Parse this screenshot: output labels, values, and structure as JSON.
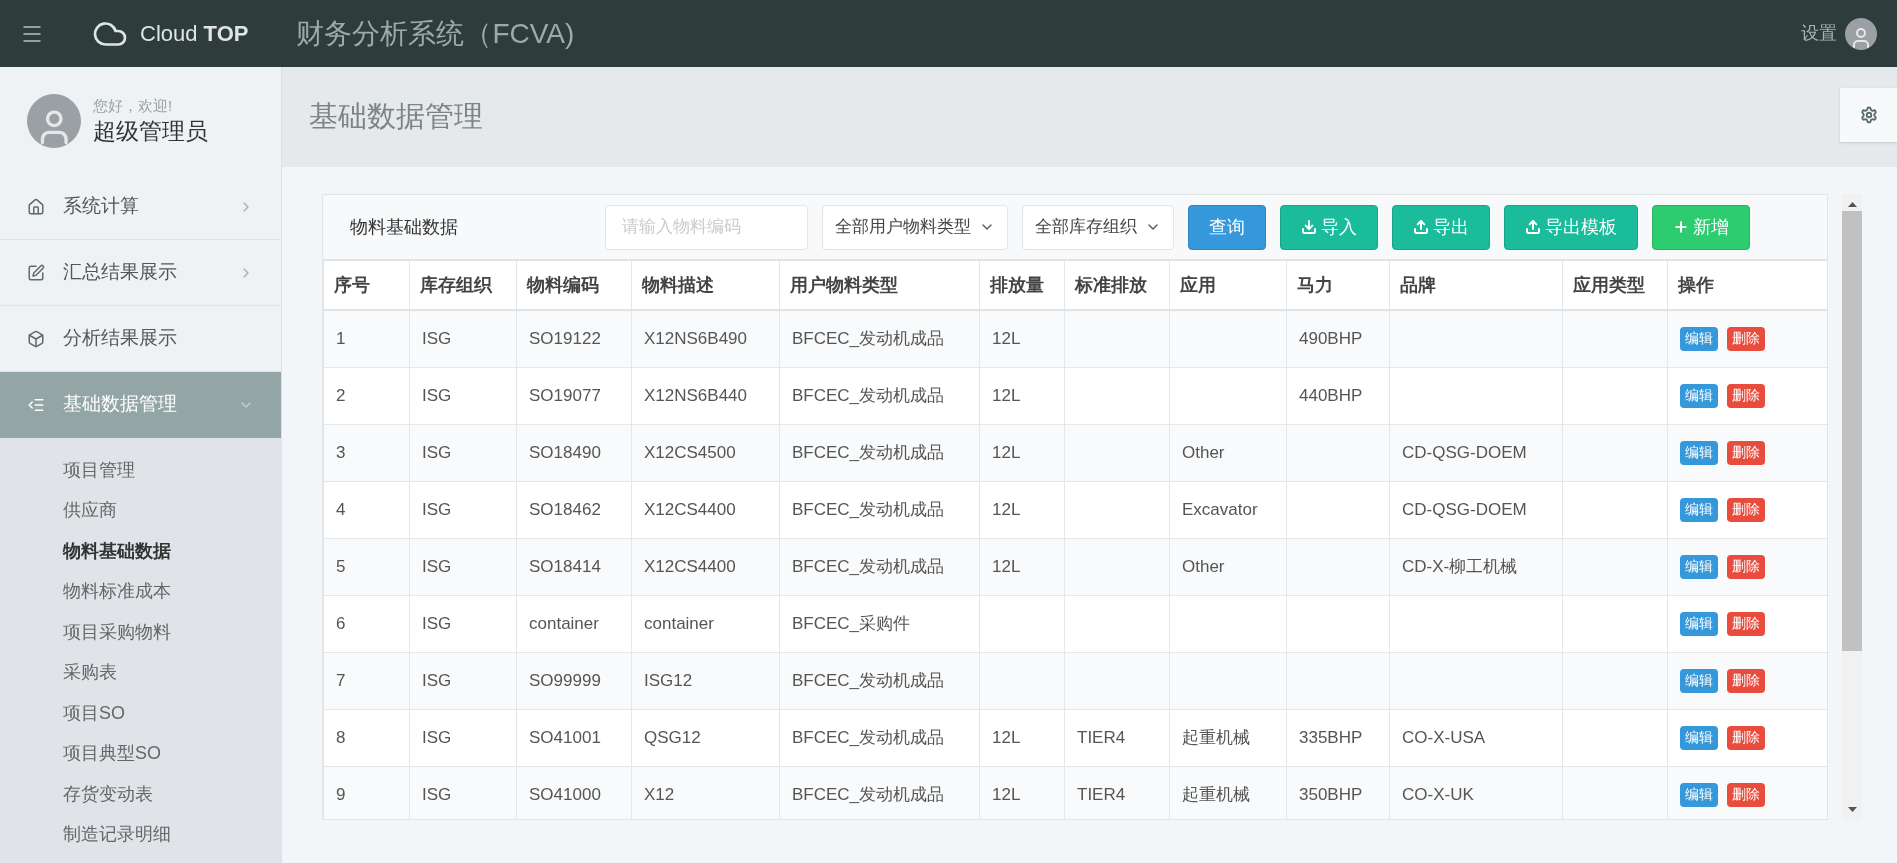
{
  "header": {
    "brand": "Cloud **TOP**",
    "title": "财务分析系统（FCVA)",
    "settings_label": "设置"
  },
  "user": {
    "greeting": "您好，欢迎!",
    "name": "超级管理员"
  },
  "sidebar": {
    "items": [
      {
        "label": "系统计算",
        "kind": "group",
        "selected": false,
        "expanded": false
      },
      {
        "label": "汇总结果展示",
        "kind": "group",
        "selected": false,
        "expanded": false
      },
      {
        "label": "分析结果展示",
        "kind": "link",
        "selected": false
      },
      {
        "label": "基础数据管理",
        "kind": "group",
        "selected": true,
        "expanded": true,
        "children": [
          {
            "label": "项目管理",
            "selected": false
          },
          {
            "label": "供应商",
            "selected": false
          },
          {
            "label": "物料基础数据",
            "selected": true
          },
          {
            "label": "物料标准成本",
            "selected": false
          },
          {
            "label": "项目采购物料",
            "selected": false
          },
          {
            "label": "采购表",
            "selected": false
          },
          {
            "label": "项目SO",
            "selected": false
          },
          {
            "label": "项目典型SO",
            "selected": false
          },
          {
            "label": "存货变动表",
            "selected": false
          },
          {
            "label": "制造记录明细",
            "selected": false
          }
        ]
      }
    ]
  },
  "page_title": "基础数据管理",
  "panel": {
    "title": "物料基础数据",
    "search": {
      "placeholder": "请输入物料编码"
    },
    "filters": [
      "全部用户物料类型",
      "全部库存组织"
    ],
    "buttons": [
      {
        "label": "查询",
        "kind": "query"
      },
      {
        "label": "导入",
        "kind": "import"
      },
      {
        "label": "导出",
        "kind": "export"
      },
      {
        "label": "导出模板",
        "kind": "template"
      },
      {
        "label": "新增",
        "kind": "add"
      }
    ]
  },
  "table": {
    "columns": [
      "序号",
      "库存组织",
      "物料编码",
      "物料描述",
      "用户物料类型",
      "排放量",
      "标准排放",
      "应用",
      "马力",
      "品牌",
      "应用类型",
      "操作"
    ],
    "rows": [
      {
        "cells": [
          "1",
          "ISG",
          "SO19122",
          "X12NS6B490",
          "BFCEC_发动机成品",
          "12L",
          "",
          "",
          "490BHP",
          "",
          ""
        ],
        "actions": [
          "编辑",
          "删除"
        ]
      },
      {
        "cells": [
          "2",
          "ISG",
          "SO19077",
          "X12NS6B440",
          "BFCEC_发动机成品",
          "12L",
          "",
          "",
          "440BHP",
          "",
          ""
        ],
        "actions": [
          "编辑",
          "删除"
        ]
      },
      {
        "cells": [
          "3",
          "ISG",
          "SO18490",
          "X12CS4500",
          "BFCEC_发动机成品",
          "12L",
          "",
          "Other",
          "",
          "CD-QSG-DOEM",
          ""
        ],
        "actions": [
          "编辑",
          "删除"
        ]
      },
      {
        "cells": [
          "4",
          "ISG",
          "SO18462",
          "X12CS4400",
          "BFCEC_发动机成品",
          "12L",
          "",
          "Excavator",
          "",
          "CD-QSG-DOEM",
          ""
        ],
        "actions": [
          "编辑",
          "删除"
        ]
      },
      {
        "cells": [
          "5",
          "ISG",
          "SO18414",
          "X12CS4400",
          "BFCEC_发动机成品",
          "12L",
          "",
          "Other",
          "",
          "CD-X-柳工机械",
          ""
        ],
        "actions": [
          "编辑",
          "删除"
        ]
      },
      {
        "cells": [
          "6",
          "ISG",
          "container",
          "container",
          "BFCEC_采购件",
          "",
          "",
          "",
          "",
          "",
          ""
        ],
        "actions": [
          "编辑",
          "删除"
        ]
      },
      {
        "cells": [
          "7",
          "ISG",
          "SO99999",
          "ISG12",
          "BFCEC_发动机成品",
          "",
          "",
          "",
          "",
          "",
          ""
        ],
        "actions": [
          "编辑",
          "删除"
        ]
      },
      {
        "cells": [
          "8",
          "ISG",
          "SO41001",
          "QSG12",
          "BFCEC_发动机成品",
          "12L",
          "TIER4",
          "起重机械",
          "335BHP",
          "CO-X-USA",
          ""
        ],
        "actions": [
          "编辑",
          "删除"
        ]
      },
      {
        "cells": [
          "9",
          "ISG",
          "SO41000",
          "X12",
          "BFCEC_发动机成品",
          "12L",
          "TIER4",
          "起重机械",
          "350BHP",
          "CO-X-UK",
          ""
        ],
        "actions": [
          "编辑",
          "删除"
        ]
      }
    ]
  }
}
